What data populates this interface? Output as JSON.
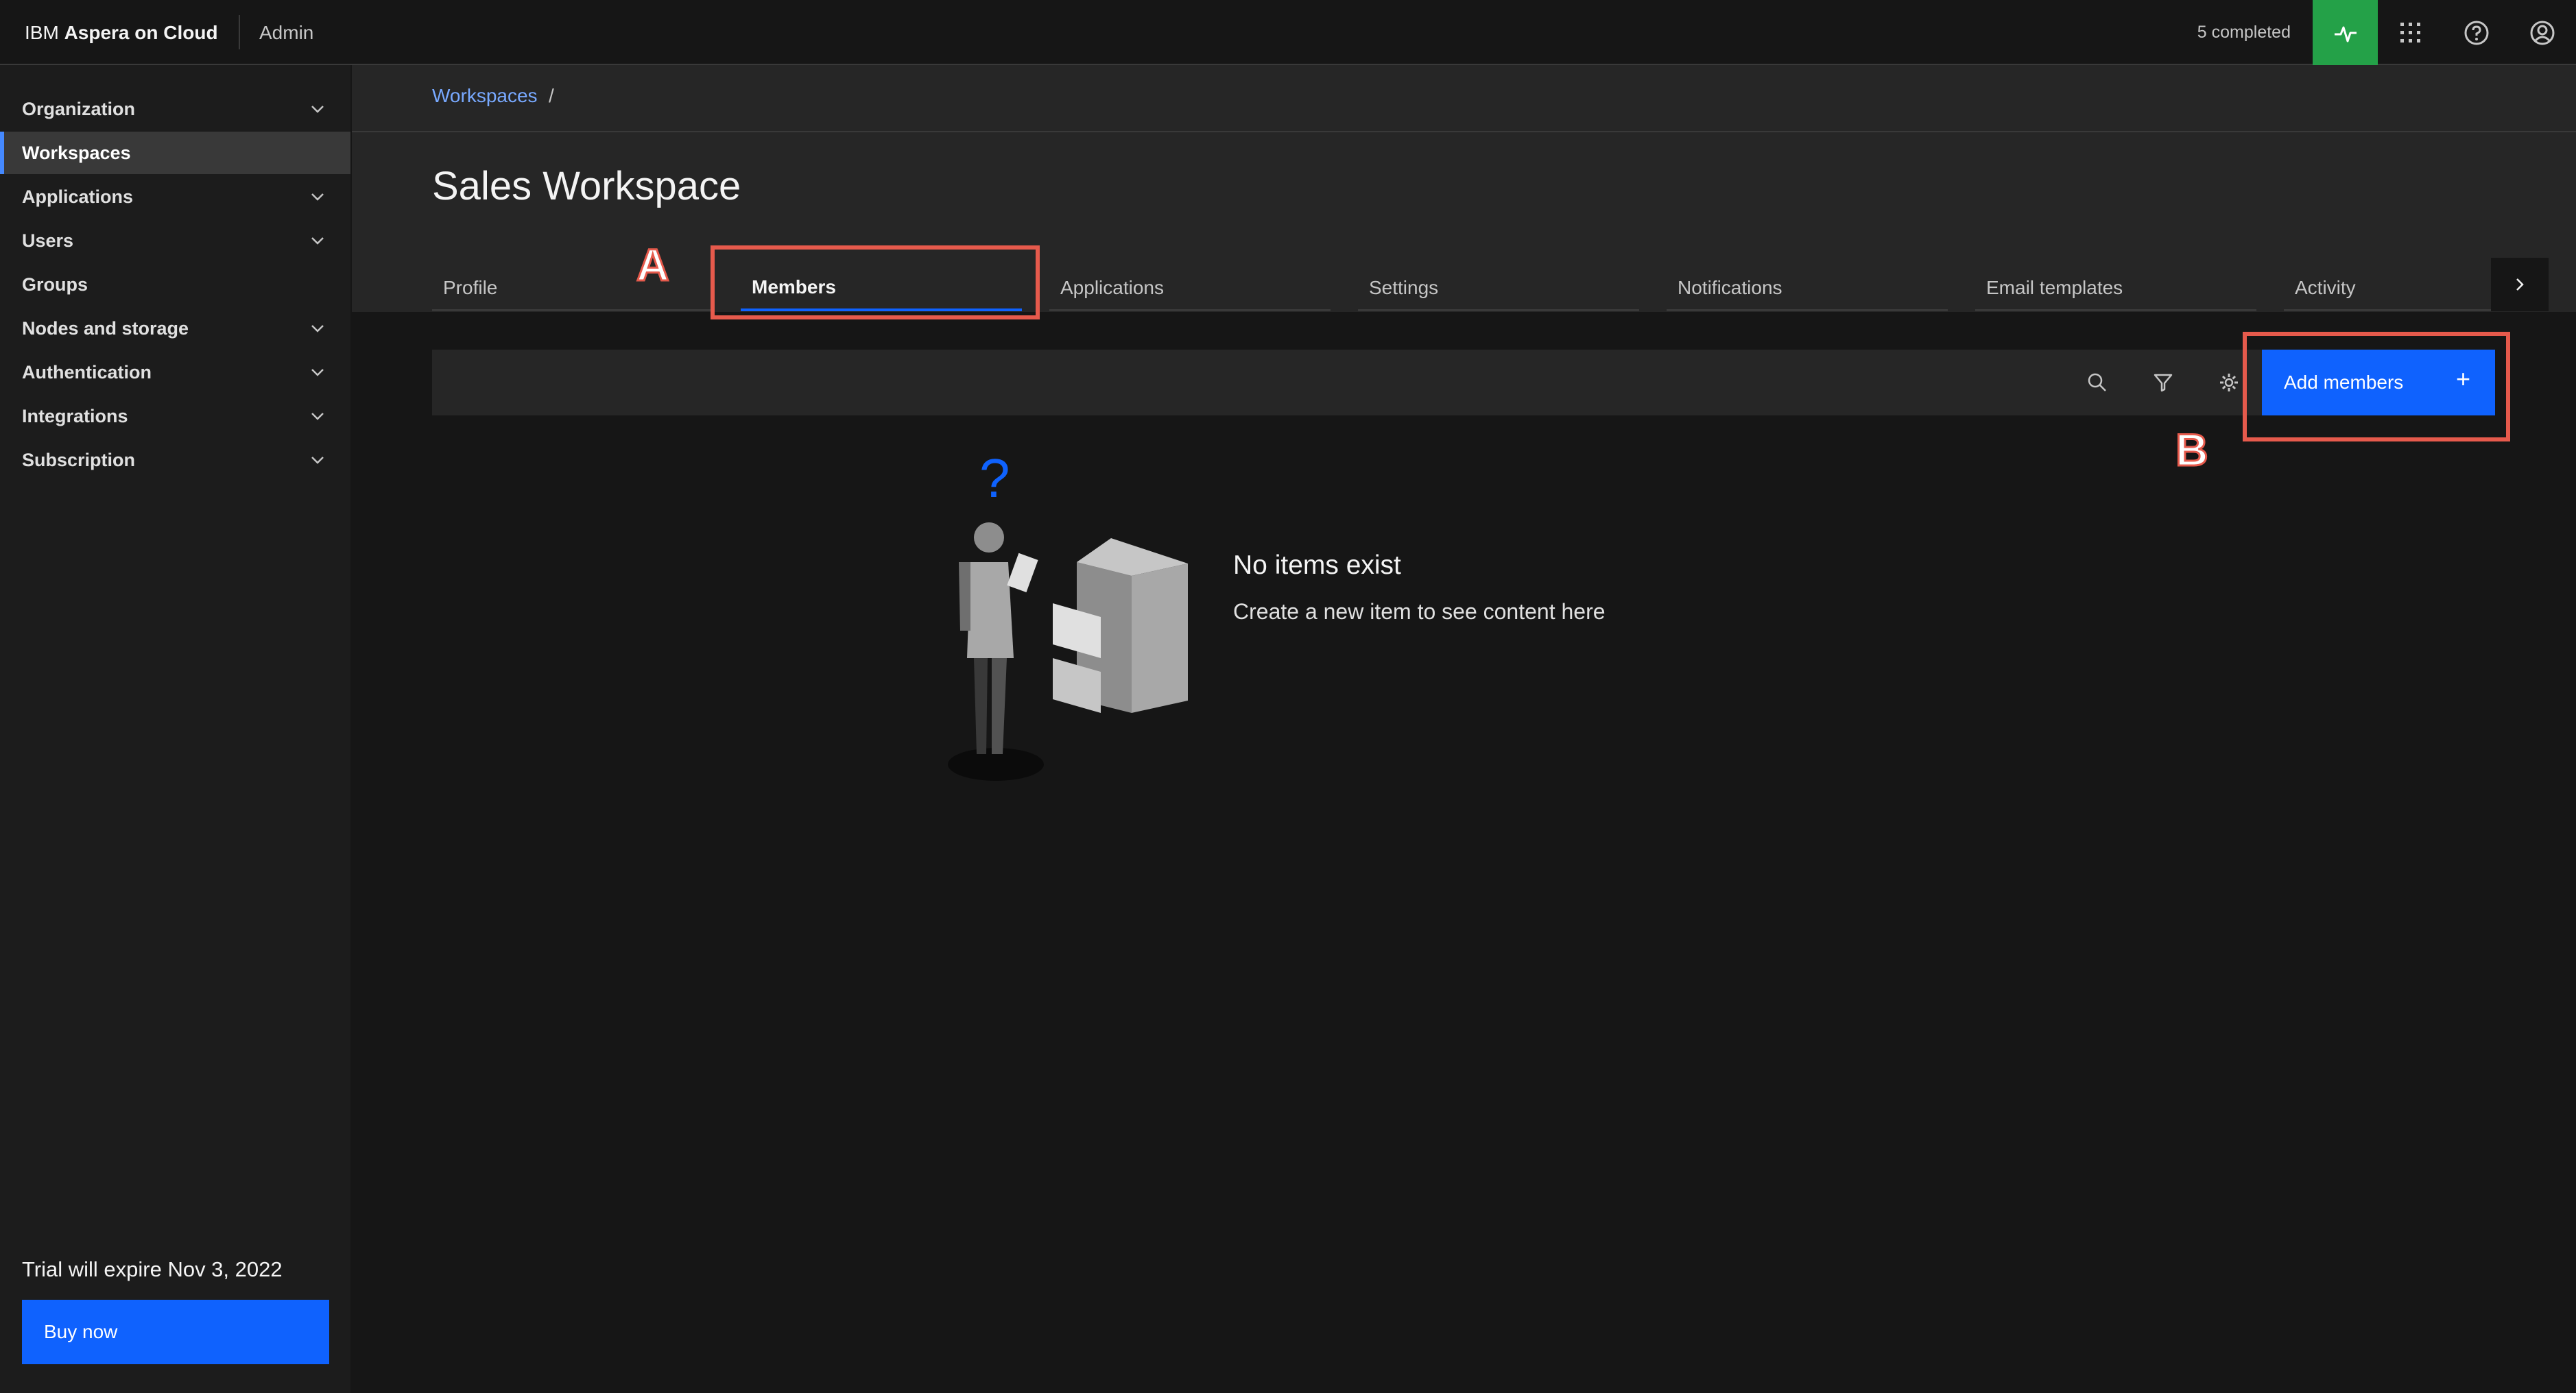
{
  "header": {
    "brand_prefix": "IBM",
    "brand_name": "Aspera on Cloud",
    "section": "Admin",
    "transfers_status": "5 completed",
    "icons": [
      "activity-icon",
      "app-switcher-icon",
      "help-icon",
      "user-avatar-icon"
    ]
  },
  "sidebar": {
    "items": [
      {
        "label": "Organization",
        "expandable": true
      },
      {
        "label": "Workspaces",
        "expandable": false,
        "active": true
      },
      {
        "label": "Applications",
        "expandable": true
      },
      {
        "label": "Users",
        "expandable": true
      },
      {
        "label": "Groups",
        "expandable": false
      },
      {
        "label": "Nodes and storage",
        "expandable": true
      },
      {
        "label": "Authentication",
        "expandable": true
      },
      {
        "label": "Integrations",
        "expandable": true
      },
      {
        "label": "Subscription",
        "expandable": true
      }
    ],
    "trial_text": "Trial will expire Nov 3, 2022",
    "buy_label": "Buy now"
  },
  "breadcrumb": {
    "link": "Workspaces",
    "separator": "/"
  },
  "page": {
    "title": "Sales Workspace"
  },
  "tabs": [
    {
      "label": "Profile"
    },
    {
      "label": "Members",
      "active": true
    },
    {
      "label": "Applications"
    },
    {
      "label": "Settings"
    },
    {
      "label": "Notifications"
    },
    {
      "label": "Email templates"
    },
    {
      "label": "Activity"
    }
  ],
  "toolbar": {
    "icons": [
      "search-icon",
      "filter-icon",
      "settings-icon"
    ],
    "add_label": "Add members",
    "add_symbol": "+"
  },
  "empty_state": {
    "title": "No items exist",
    "subtitle": "Create a new item to see content here",
    "question_mark": "?"
  },
  "annotations": {
    "a": "A",
    "b": "B",
    "color": "#e65a4c"
  },
  "colors": {
    "background": "#161616",
    "panel": "#262626",
    "primary": "#0f62fe",
    "link": "#78a9ff",
    "success": "#24a148"
  }
}
